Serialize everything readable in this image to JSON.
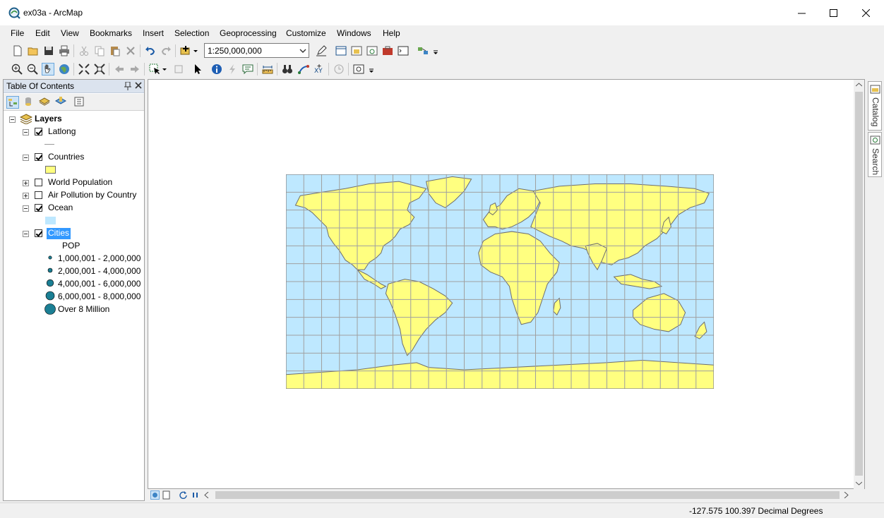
{
  "window": {
    "title": "ex03a - ArcMap"
  },
  "menu": [
    "File",
    "Edit",
    "View",
    "Bookmarks",
    "Insert",
    "Selection",
    "Geoprocessing",
    "Customize",
    "Windows",
    "Help"
  ],
  "toolbar": {
    "scale_value": "1:250,000,000"
  },
  "toc": {
    "title": "Table Of Contents",
    "root_label": "Layers",
    "layers": [
      {
        "label": "Latlong",
        "checked": true,
        "expanded": true
      },
      {
        "label": "Countries",
        "checked": true,
        "expanded": true,
        "swatch": "#ffff80"
      },
      {
        "label": "World Population",
        "checked": false,
        "expanded": false
      },
      {
        "label": "Air Pollution by Country",
        "checked": false,
        "expanded": false
      },
      {
        "label": "Ocean",
        "checked": true,
        "expanded": true,
        "swatch": "#bee8ff"
      },
      {
        "label": "Cities",
        "checked": true,
        "expanded": true,
        "selected": true
      }
    ],
    "cities_field": "POP",
    "cities_classes": [
      "1,000,001 - 2,000,000",
      "2,000,001 - 4,000,000",
      "4,000,001 - 6,000,000",
      "6,000,001 - 8,000,000",
      "Over 8 Million"
    ]
  },
  "dock": {
    "catalog": "Catalog",
    "search": "Search"
  },
  "status": {
    "coordinates": "-127.575  100.397 Decimal Degrees"
  },
  "colors": {
    "ocean": "#bee8ff",
    "land": "#ffff80",
    "coast": "#6e6e6e",
    "grid": "#a0a0a0",
    "symbol": "#1b7f94"
  }
}
